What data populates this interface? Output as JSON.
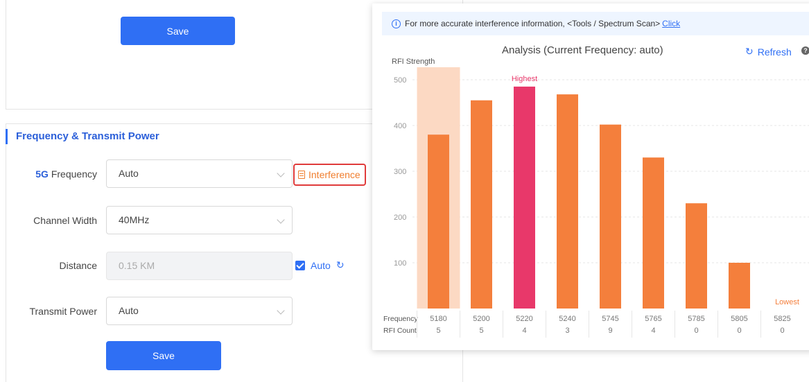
{
  "top_section": {
    "save_label": "Save"
  },
  "frequency_section": {
    "title": "Frequency & Transmit Power",
    "frequency": {
      "label_accent": "5G",
      "label_rest": " Frequency",
      "value": "Auto"
    },
    "interference_label": "Interference",
    "channel_width": {
      "label": "Channel Width",
      "value": "40MHz"
    },
    "distance": {
      "label": "Distance",
      "placeholder": "0.15 KM",
      "auto_label": "Auto"
    },
    "transmit_power": {
      "label": "Transmit Power",
      "value": "Auto"
    },
    "save_label": "Save"
  },
  "panel": {
    "notice_text": "For more accurate interference information, <Tools / Spectrum Scan>",
    "notice_link": "Click",
    "title": "Analysis (Current Frequency: auto)",
    "refresh_label": "Refresh"
  },
  "chart_data": {
    "type": "bar",
    "ylabel": "RFI Strength",
    "ylim": [
      0,
      530
    ],
    "yticks": [
      100,
      200,
      300,
      400,
      500
    ],
    "row_labels": [
      "Frequency",
      "RFI Count"
    ],
    "categories": [
      "5180",
      "5200",
      "5220",
      "5240",
      "5745",
      "5765",
      "5785",
      "5805",
      "5825"
    ],
    "values": [
      380,
      455,
      485,
      468,
      402,
      330,
      230,
      100,
      0
    ],
    "rfi_counts": [
      "5",
      "5",
      "4",
      "3",
      "9",
      "4",
      "0",
      "0",
      "0"
    ],
    "selected_index": 0,
    "highest_index": 2,
    "lowest_index": 8,
    "highest_label": "Highest",
    "lowest_label": "Lowest",
    "colors": {
      "bar": "#f47f3c",
      "highest": "#e8386a",
      "selected_bg": "#fcd9c3",
      "grid": "#e6e6e6",
      "axis_text": "#999999",
      "highest_text": "#e8386a",
      "lowest_text": "#f47f3c"
    }
  }
}
